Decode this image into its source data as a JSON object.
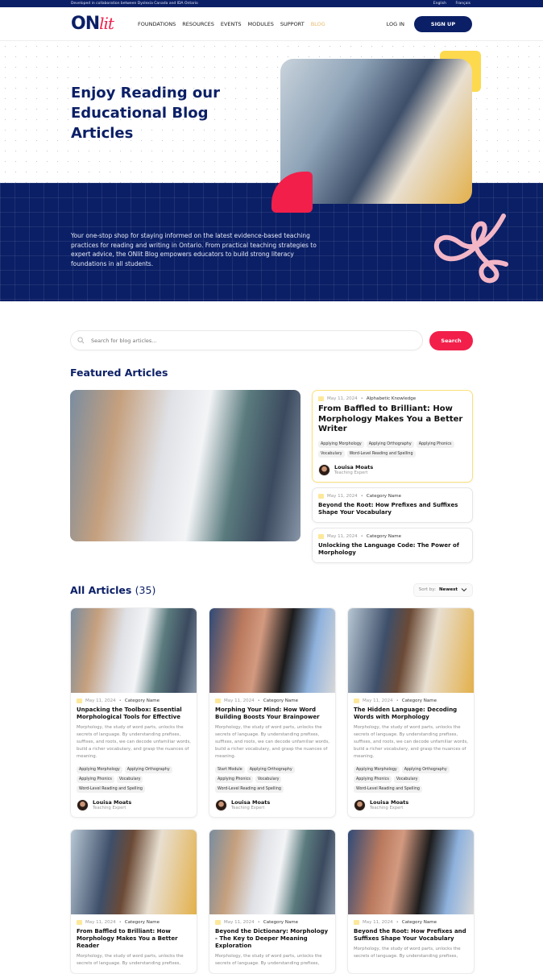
{
  "topbar": {
    "note": "Developed in collaboration between Dyslexia Canada and IDA Ontario",
    "languages": [
      "English",
      "Français"
    ]
  },
  "header": {
    "logo_on": "ON",
    "logo_lit": "lit",
    "nav": [
      "FOUNDATIONS",
      "RESOURCES",
      "EVENTS",
      "MODULES",
      "SUPPORT",
      "BLOG"
    ],
    "active_nav": "BLOG",
    "login": "LOG IN",
    "signup": "SIGN UP"
  },
  "hero": {
    "title": "Enjoy Reading our Educational Blog Articles",
    "description": "Your one-stop shop for staying informed on the latest evidence-based teaching practices for reading and writing in Ontario. From practical teaching strategies to expert advice, the ONlit Blog empowers educators to build strong literacy foundations in all students.",
    "colors": {
      "navy": "#0b1f66",
      "red": "#f21f4b",
      "yellow": "#fdd94e",
      "pink": "#f3b6c6"
    }
  },
  "search": {
    "placeholder": "Search for blog articles...",
    "button": "Search"
  },
  "featured": {
    "title": "Featured Articles",
    "main": {
      "date": "May 11, 2024",
      "category": "Alphabetic Knowledge",
      "title": "From Baffled to Brilliant: How Morphology Makes You a Better Writer",
      "tags": [
        "Applying Morphology",
        "Applying Orthography",
        "Applying Phonics",
        "Vocabulary",
        "Word-Level Reading and Spelling"
      ],
      "author": "Louisa Moats",
      "role": "Teaching Expert"
    },
    "others": [
      {
        "date": "May 11, 2024",
        "category": "Category Name",
        "title": "Beyond the Root: How Prefixes and Suffixes Shape Your Vocabulary"
      },
      {
        "date": "May 11, 2024",
        "category": "Category Name",
        "title": "Unlocking the Language Code: The Power of Morphology"
      }
    ]
  },
  "all_articles": {
    "title": "All Articles",
    "count": "(35)",
    "sort_label": "Sort by:",
    "sort_value": "Newest",
    "cards": [
      {
        "date": "May 11, 2024",
        "category": "Category Name",
        "title": "Unpacking the Toolbox: Essential Morphological Tools for Effective",
        "excerpt": "Morphology, the study of word parts, unlocks the secrets of language. By understanding prefixes, suffixes, and roots, we can decode unfamiliar words, build a richer vocabulary, and grasp the nuances of meaning.",
        "tags": [
          "Applying Morphology",
          "Applying Orthography",
          "Applying Phonics",
          "Vocabulary",
          "Word-Level Reading and Spelling"
        ],
        "author": "Louisa Moats",
        "role": "Teaching Expert"
      },
      {
        "date": "May 11, 2024",
        "category": "Category Name",
        "title": "Morphing Your Mind: How Word Building Boosts Your Brainpower",
        "excerpt": "Morphology, the study of word parts, unlocks the secrets of language. By understanding prefixes, suffixes, and roots, we can decode unfamiliar words, build a richer vocabulary, and grasp the nuances of meaning.",
        "tags": [
          "Start Module",
          "Applying Orthography",
          "Applying Phonics",
          "Vocabulary",
          "Word-Level Reading and Spelling"
        ],
        "author": "Louisa Moats",
        "role": "Teaching Expert"
      },
      {
        "date": "May 11, 2024",
        "category": "Category Name",
        "title": "The Hidden Language: Decoding Words with Morphology",
        "excerpt": "Morphology, the study of word parts, unlocks the secrets of language. By understanding prefixes, suffixes, and roots, we can decode unfamiliar words, build a richer vocabulary, and grasp the nuances of meaning.",
        "tags": [
          "Applying Morphology",
          "Applying Orthography",
          "Applying Phonics",
          "Vocabulary",
          "Word-Level Reading and Spelling"
        ],
        "author": "Louisa Moats",
        "role": "Teaching Expert"
      },
      {
        "date": "May 11, 2024",
        "category": "Category Name",
        "title": "From Baffled to Brilliant: How Morphology Makes You a Better Reader",
        "excerpt": "Morphology, the study of word parts, unlocks the secrets of language. By understanding prefixes,"
      },
      {
        "date": "May 11, 2024",
        "category": "Category Name",
        "title": "Beyond the Dictionary: Morphology - The Key to Deeper Meaning Exploration",
        "excerpt": "Morphology, the study of word parts, unlocks the secrets of language. By understanding prefixes,"
      },
      {
        "date": "May 11, 2024",
        "category": "Category Name",
        "title": "Beyond the Root: How Prefixes and Suffixes Shape Your Vocabulary",
        "excerpt": "Morphology, the study of word parts, unlocks the secrets of language. By understanding prefixes,"
      }
    ]
  }
}
